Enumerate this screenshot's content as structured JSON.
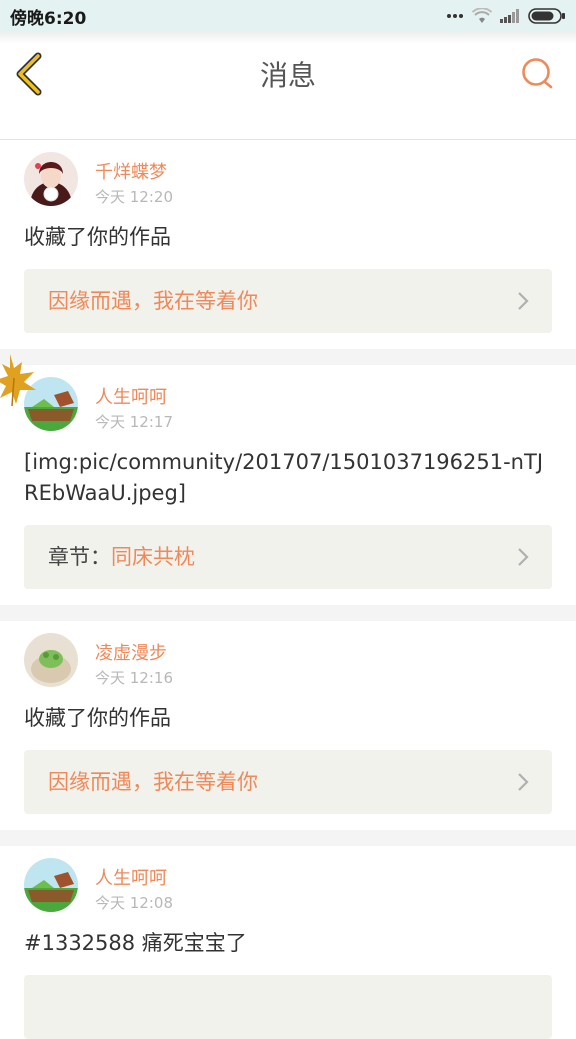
{
  "status_bar": {
    "time": "傍晚6:20",
    "icons": [
      "more-dots-icon",
      "wifi-icon",
      "signal-icon",
      "battery-icon"
    ]
  },
  "header": {
    "title": "消息",
    "back_icon": "back-chevron-icon",
    "search_icon": "search-icon"
  },
  "colors": {
    "accent": "#f0895a",
    "back_arrow": "#f0c020",
    "link_box": "#f2f2ec",
    "status_bar": "#e4f3f1"
  },
  "messages": [
    {
      "user": "千烊蝶梦",
      "time": "今天 12:20",
      "text": "收藏了你的作品",
      "link_prefix": "",
      "link_text": "因缘而遇，我在等着你"
    },
    {
      "user": "人生呵呵",
      "time": "今天 12:17",
      "text": "[img:pic/community/201707/1501037196251-nTJREbWaaU.jpeg]",
      "link_prefix": "章节：",
      "link_text": "同床共枕"
    },
    {
      "user": "凌虚漫步",
      "time": "今天 12:16",
      "text": "收藏了你的作品",
      "link_prefix": "",
      "link_text": "因缘而遇，我在等着你"
    },
    {
      "user": "人生呵呵",
      "time": "今天 12:08",
      "text": "#1332588 痛死宝宝了",
      "link_prefix": "",
      "link_text": ""
    }
  ]
}
